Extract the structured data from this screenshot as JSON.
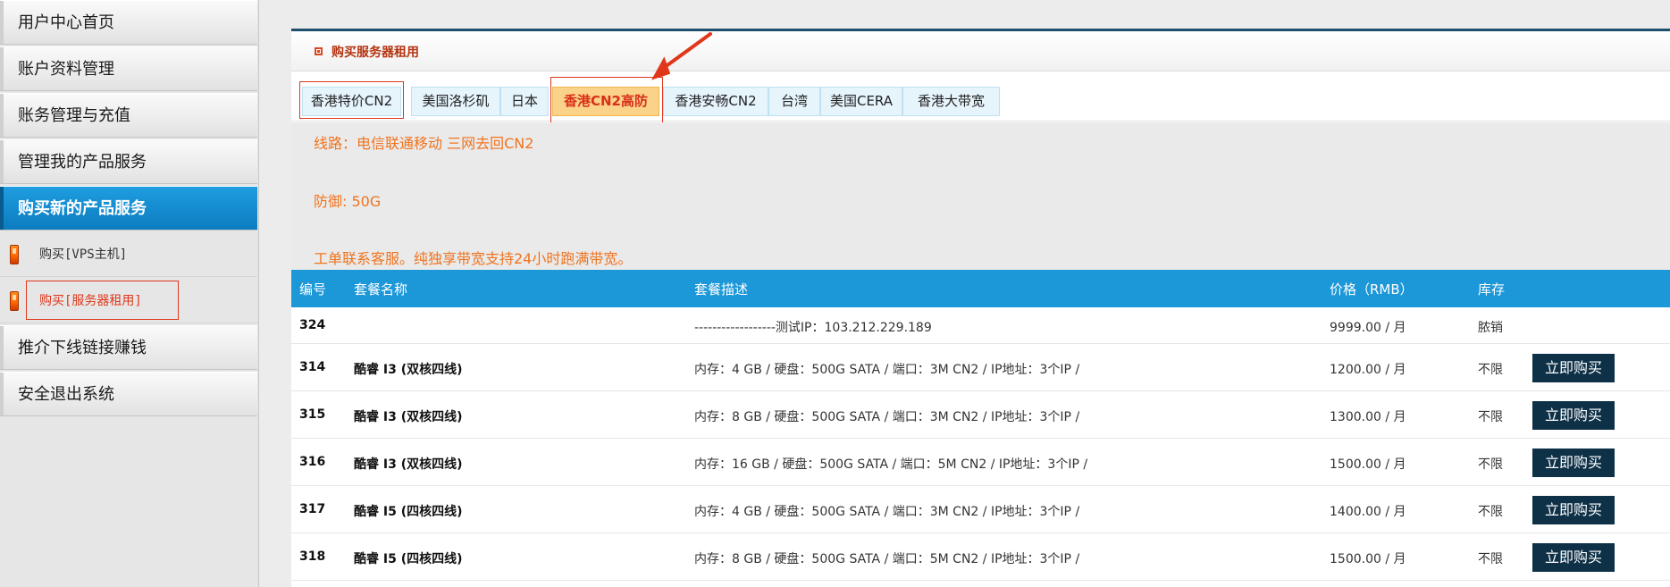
{
  "sidebar": {
    "items": [
      {
        "label": "用户中心首页"
      },
      {
        "label": "账户资料管理"
      },
      {
        "label": "账务管理与充值"
      },
      {
        "label": "管理我的产品服务"
      },
      {
        "label": "购买新的产品服务"
      },
      {
        "label": "推介下线链接赚钱"
      },
      {
        "label": "安全退出系统"
      }
    ],
    "sub_items": [
      {
        "label": "购买[VPS主机]"
      },
      {
        "label": "购买[服务器租用]"
      }
    ]
  },
  "panel": {
    "title": "购买服务器租用"
  },
  "tabs": [
    {
      "label": "香港特价CN2"
    },
    {
      "label": "美国洛杉矶"
    },
    {
      "label": "日本"
    },
    {
      "label": "香港CN2高防",
      "active": true
    },
    {
      "label": "香港安畅CN2"
    },
    {
      "label": "台湾"
    },
    {
      "label": "美国CERA"
    },
    {
      "label": "香港大带宽"
    }
  ],
  "info": {
    "line1": "线路：电信联通移动 三网去回CN2",
    "line2": "防御: 50G",
    "line3": "工单联系客服。纯独享带宽支持24小时跑满带宽。"
  },
  "table": {
    "headers": [
      "编号",
      "套餐名称",
      "套餐描述",
      "价格（RMB）",
      "库存"
    ],
    "buy_label": "立即购买",
    "rows": [
      {
        "id": "324",
        "name": "",
        "desc": "------------------测试IP：103.212.229.189",
        "price": "9999.00 / 月",
        "stock": "脓销",
        "buy": false
      },
      {
        "id": "314",
        "name": "酷睿 I3 (双核四线)",
        "desc": "内存：4 GB / 硬盘：500G SATA / 端口：3M CN2 / IP地址：3个IP /",
        "price": "1200.00 / 月",
        "stock": "不限",
        "buy": true
      },
      {
        "id": "315",
        "name": "酷睿 I3 (双核四线)",
        "desc": "内存：8 GB / 硬盘：500G SATA / 端口：3M CN2 / IP地址：3个IP /",
        "price": "1300.00 / 月",
        "stock": "不限",
        "buy": true
      },
      {
        "id": "316",
        "name": "酷睿 I3 (双核四线)",
        "desc": "内存：16 GB / 硬盘：500G SATA / 端口：5M CN2 / IP地址：3个IP /",
        "price": "1500.00 / 月",
        "stock": "不限",
        "buy": true
      },
      {
        "id": "317",
        "name": "酷睿 I5 (四核四线)",
        "desc": "内存：4 GB / 硬盘：500G SATA / 端口：3M CN2 / IP地址：3个IP /",
        "price": "1400.00 / 月",
        "stock": "不限",
        "buy": true
      },
      {
        "id": "318",
        "name": "酷睿 I5 (四核四线)",
        "desc": "内存：8 GB / 硬盘：500G SATA / 端口：5M CN2 / IP地址：3个IP /",
        "price": "1500.00 / 月",
        "stock": "不限",
        "buy": true
      }
    ]
  },
  "colors": {
    "accent": "#1c97d8",
    "active_tab": "#fbd28a",
    "annotation_red": "#e0371b",
    "info_text": "#ef7420",
    "button": "#0e3148"
  }
}
